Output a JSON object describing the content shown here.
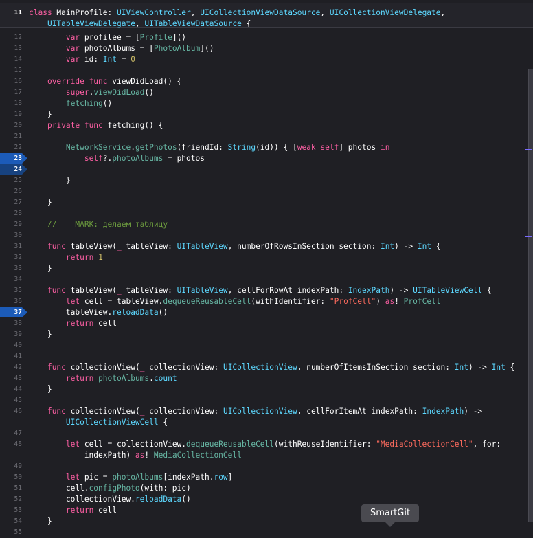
{
  "window": {
    "tooltip": "SmartGit"
  },
  "colors": {
    "background": "#1f1f24",
    "keyword": "#fc5fa3",
    "type": "#5dd8ff",
    "project": "#67b7a4",
    "string": "#fc6a5d",
    "number": "#d0bf69",
    "comment": "#6c9b3e",
    "breakpoint": "#1c5bb8"
  },
  "lines": [
    {
      "n": "11",
      "current": true,
      "tokens": [
        [
          "k",
          "class"
        ],
        [
          "w",
          " MainProfile: "
        ],
        [
          "t",
          "UIViewController"
        ],
        [
          "w",
          ", "
        ],
        [
          "t",
          "UICollectionViewDataSource"
        ],
        [
          "w",
          ", "
        ],
        [
          "t",
          "UICollectionViewDelegate"
        ],
        [
          "w",
          ","
        ]
      ]
    },
    {
      "n": "",
      "tokens": [
        [
          "w",
          "    "
        ],
        [
          "t",
          "UITableViewDelegate"
        ],
        [
          "w",
          ", "
        ],
        [
          "t",
          "UITableViewDataSource"
        ],
        [
          "w",
          " {"
        ]
      ]
    },
    {
      "n": "12",
      "tokens": [
        [
          "w",
          "        "
        ],
        [
          "k",
          "var"
        ],
        [
          "w",
          " profilee = ["
        ],
        [
          "p",
          "Profile"
        ],
        [
          "w",
          "]()"
        ]
      ]
    },
    {
      "n": "13",
      "tokens": [
        [
          "w",
          "        "
        ],
        [
          "k",
          "var"
        ],
        [
          "w",
          " photoAlbums = ["
        ],
        [
          "p",
          "PhotoAlbum"
        ],
        [
          "w",
          "]()"
        ]
      ]
    },
    {
      "n": "14",
      "tokens": [
        [
          "w",
          "        "
        ],
        [
          "k",
          "var"
        ],
        [
          "w",
          " id: "
        ],
        [
          "t",
          "Int"
        ],
        [
          "w",
          " = "
        ],
        [
          "n",
          "0"
        ]
      ]
    },
    {
      "n": "15",
      "tokens": []
    },
    {
      "n": "16",
      "tokens": [
        [
          "w",
          "    "
        ],
        [
          "k",
          "override func"
        ],
        [
          "w",
          " viewDidLoad() {"
        ]
      ]
    },
    {
      "n": "17",
      "tokens": [
        [
          "w",
          "        "
        ],
        [
          "k",
          "super"
        ],
        [
          "w",
          "."
        ],
        [
          "f",
          "viewDidLoad"
        ],
        [
          "w",
          "()"
        ]
      ]
    },
    {
      "n": "18",
      "tokens": [
        [
          "w",
          "        "
        ],
        [
          "f",
          "fetching"
        ],
        [
          "w",
          "()"
        ]
      ]
    },
    {
      "n": "19",
      "tokens": [
        [
          "w",
          "    }"
        ]
      ]
    },
    {
      "n": "20",
      "tokens": [
        [
          "w",
          "    "
        ],
        [
          "k",
          "private func"
        ],
        [
          "w",
          " fetching() {"
        ]
      ]
    },
    {
      "n": "21",
      "tokens": []
    },
    {
      "n": "22",
      "tokens": [
        [
          "w",
          "        "
        ],
        [
          "p",
          "NetworkService"
        ],
        [
          "w",
          "."
        ],
        [
          "f",
          "getPhotos"
        ],
        [
          "w",
          "(friendId: "
        ],
        [
          "t",
          "String"
        ],
        [
          "w",
          "(id)) { ["
        ],
        [
          "k",
          "weak self"
        ],
        [
          "w",
          "] photos "
        ],
        [
          "k",
          "in"
        ]
      ]
    },
    {
      "n": "23",
      "bp": "on",
      "tokens": [
        [
          "w",
          "            "
        ],
        [
          "k",
          "self"
        ],
        [
          "w",
          "?."
        ],
        [
          "p",
          "photoAlbums"
        ],
        [
          "w",
          " = photos"
        ]
      ]
    },
    {
      "n": "24",
      "bp": "dim",
      "tokens": []
    },
    {
      "n": "25",
      "tokens": [
        [
          "w",
          "        }"
        ]
      ]
    },
    {
      "n": "26",
      "tokens": []
    },
    {
      "n": "27",
      "tokens": [
        [
          "w",
          "    }"
        ]
      ]
    },
    {
      "n": "28",
      "tokens": []
    },
    {
      "n": "29",
      "tokens": [
        [
          "w",
          "    "
        ],
        [
          "c",
          "//    MARK: делаем таблицу"
        ]
      ]
    },
    {
      "n": "30",
      "tokens": []
    },
    {
      "n": "31",
      "tokens": [
        [
          "w",
          "    "
        ],
        [
          "k",
          "func"
        ],
        [
          "w",
          " tableView("
        ],
        [
          "k",
          "_"
        ],
        [
          "w",
          " tableView: "
        ],
        [
          "t",
          "UITableView"
        ],
        [
          "w",
          ", numberOfRowsInSection section: "
        ],
        [
          "t",
          "Int"
        ],
        [
          "w",
          ") -> "
        ],
        [
          "t",
          "Int"
        ],
        [
          "w",
          " {"
        ]
      ]
    },
    {
      "n": "32",
      "tokens": [
        [
          "w",
          "        "
        ],
        [
          "k",
          "return"
        ],
        [
          "w",
          " "
        ],
        [
          "n",
          "1"
        ]
      ]
    },
    {
      "n": "33",
      "tokens": [
        [
          "w",
          "    }"
        ]
      ]
    },
    {
      "n": "34",
      "tokens": []
    },
    {
      "n": "35",
      "tokens": [
        [
          "w",
          "    "
        ],
        [
          "k",
          "func"
        ],
        [
          "w",
          " tableView("
        ],
        [
          "k",
          "_"
        ],
        [
          "w",
          " tableView: "
        ],
        [
          "t",
          "UITableView"
        ],
        [
          "w",
          ", cellForRowAt indexPath: "
        ],
        [
          "t",
          "IndexPath"
        ],
        [
          "w",
          ") -> "
        ],
        [
          "t",
          "UITableViewCell"
        ],
        [
          "w",
          " {"
        ]
      ]
    },
    {
      "n": "36",
      "tokens": [
        [
          "w",
          "        "
        ],
        [
          "k",
          "let"
        ],
        [
          "w",
          " cell = tableView."
        ],
        [
          "f",
          "dequeueReusableCell"
        ],
        [
          "w",
          "(withIdentifier: "
        ],
        [
          "s",
          "\"ProfCell\""
        ],
        [
          "w",
          ") "
        ],
        [
          "k",
          "as"
        ],
        [
          "w",
          "! "
        ],
        [
          "p",
          "ProfCell"
        ]
      ]
    },
    {
      "n": "37",
      "bp": "on",
      "tokens": [
        [
          "w",
          "        tableView."
        ],
        [
          "t",
          "reloadData"
        ],
        [
          "w",
          "()"
        ]
      ]
    },
    {
      "n": "38",
      "tokens": [
        [
          "w",
          "        "
        ],
        [
          "k",
          "return"
        ],
        [
          "w",
          " cell"
        ]
      ]
    },
    {
      "n": "39",
      "tokens": [
        [
          "w",
          "    }"
        ]
      ]
    },
    {
      "n": "40",
      "tokens": []
    },
    {
      "n": "41",
      "tokens": []
    },
    {
      "n": "42",
      "tokens": [
        [
          "w",
          "    "
        ],
        [
          "k",
          "func"
        ],
        [
          "w",
          " collectionView("
        ],
        [
          "k",
          "_"
        ],
        [
          "w",
          " collectionView: "
        ],
        [
          "t",
          "UICollectionView"
        ],
        [
          "w",
          ", numberOfItemsInSection section: "
        ],
        [
          "t",
          "Int"
        ],
        [
          "w",
          ") -> "
        ],
        [
          "t",
          "Int"
        ],
        [
          "w",
          " {"
        ]
      ]
    },
    {
      "n": "43",
      "tokens": [
        [
          "w",
          "        "
        ],
        [
          "k",
          "return"
        ],
        [
          "w",
          " "
        ],
        [
          "p",
          "photoAlbums"
        ],
        [
          "w",
          "."
        ],
        [
          "t",
          "count"
        ]
      ]
    },
    {
      "n": "44",
      "tokens": [
        [
          "w",
          "    }"
        ]
      ]
    },
    {
      "n": "45",
      "tokens": []
    },
    {
      "n": "46",
      "tokens": [
        [
          "w",
          "    "
        ],
        [
          "k",
          "func"
        ],
        [
          "w",
          " collectionView("
        ],
        [
          "k",
          "_"
        ],
        [
          "w",
          " collectionView: "
        ],
        [
          "t",
          "UICollectionView"
        ],
        [
          "w",
          ", cellForItemAt indexPath: "
        ],
        [
          "t",
          "IndexPath"
        ],
        [
          "w",
          ") ->"
        ]
      ]
    },
    {
      "n": "",
      "tokens": [
        [
          "w",
          "        "
        ],
        [
          "t",
          "UICollectionViewCell"
        ],
        [
          "w",
          " {"
        ]
      ]
    },
    {
      "n": "47",
      "tokens": []
    },
    {
      "n": "48",
      "tokens": [
        [
          "w",
          "        "
        ],
        [
          "k",
          "let"
        ],
        [
          "w",
          " cell = collectionView."
        ],
        [
          "f",
          "dequeueReusableCell"
        ],
        [
          "w",
          "(withReuseIdentifier: "
        ],
        [
          "s",
          "\"MediaCollectionCell\""
        ],
        [
          "w",
          ", for:"
        ]
      ]
    },
    {
      "n": "",
      "tokens": [
        [
          "w",
          "            indexPath) "
        ],
        [
          "k",
          "as"
        ],
        [
          "w",
          "! "
        ],
        [
          "p",
          "MediaCollectionCell"
        ]
      ]
    },
    {
      "n": "49",
      "tokens": []
    },
    {
      "n": "50",
      "tokens": [
        [
          "w",
          "        "
        ],
        [
          "k",
          "let"
        ],
        [
          "w",
          " pic = "
        ],
        [
          "p",
          "photoAlbums"
        ],
        [
          "w",
          "[indexPath."
        ],
        [
          "t",
          "row"
        ],
        [
          "w",
          "]"
        ]
      ]
    },
    {
      "n": "51",
      "tokens": [
        [
          "w",
          "        cell."
        ],
        [
          "f",
          "configPhoto"
        ],
        [
          "w",
          "(with: pic)"
        ]
      ]
    },
    {
      "n": "52",
      "tokens": [
        [
          "w",
          "        collectionView."
        ],
        [
          "t",
          "reloadData"
        ],
        [
          "w",
          "()"
        ]
      ]
    },
    {
      "n": "53",
      "tokens": [
        [
          "w",
          "        "
        ],
        [
          "k",
          "return"
        ],
        [
          "w",
          " cell"
        ]
      ]
    },
    {
      "n": "54",
      "tokens": [
        [
          "w",
          "    }"
        ]
      ]
    },
    {
      "n": "55",
      "tokens": []
    }
  ]
}
